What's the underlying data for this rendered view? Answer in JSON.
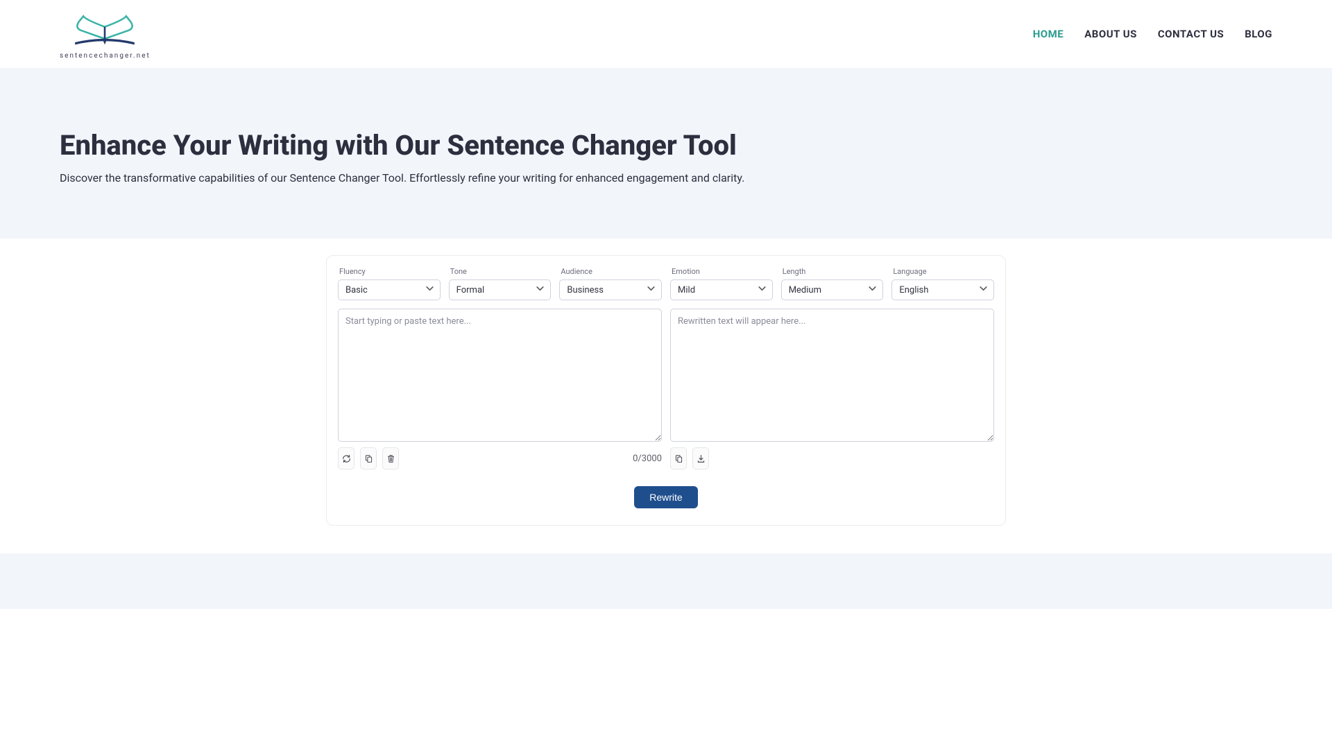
{
  "brand": {
    "tagline": "sentencechanger.net"
  },
  "nav": {
    "items": [
      {
        "label": "HOME",
        "active": true
      },
      {
        "label": "ABOUT US",
        "active": false
      },
      {
        "label": "CONTACT US",
        "active": false
      },
      {
        "label": "BLOG",
        "active": false
      }
    ]
  },
  "hero": {
    "title": "Enhance Your Writing with Our Sentence Changer Tool",
    "subtitle": "Discover the transformative capabilities of our Sentence Changer Tool. Effortlessly refine your writing for enhanced engagement and clarity."
  },
  "tool": {
    "selects": [
      {
        "label": "Fluency",
        "value": "Basic"
      },
      {
        "label": "Tone",
        "value": "Formal"
      },
      {
        "label": "Audience",
        "value": "Business"
      },
      {
        "label": "Emotion",
        "value": "Mild"
      },
      {
        "label": "Length",
        "value": "Medium"
      },
      {
        "label": "Language",
        "value": "English"
      }
    ],
    "input_placeholder": "Start typing or paste text here...",
    "output_placeholder": "Rewritten text will appear here...",
    "counter": "0/3000",
    "rewrite_label": "Rewrite"
  }
}
